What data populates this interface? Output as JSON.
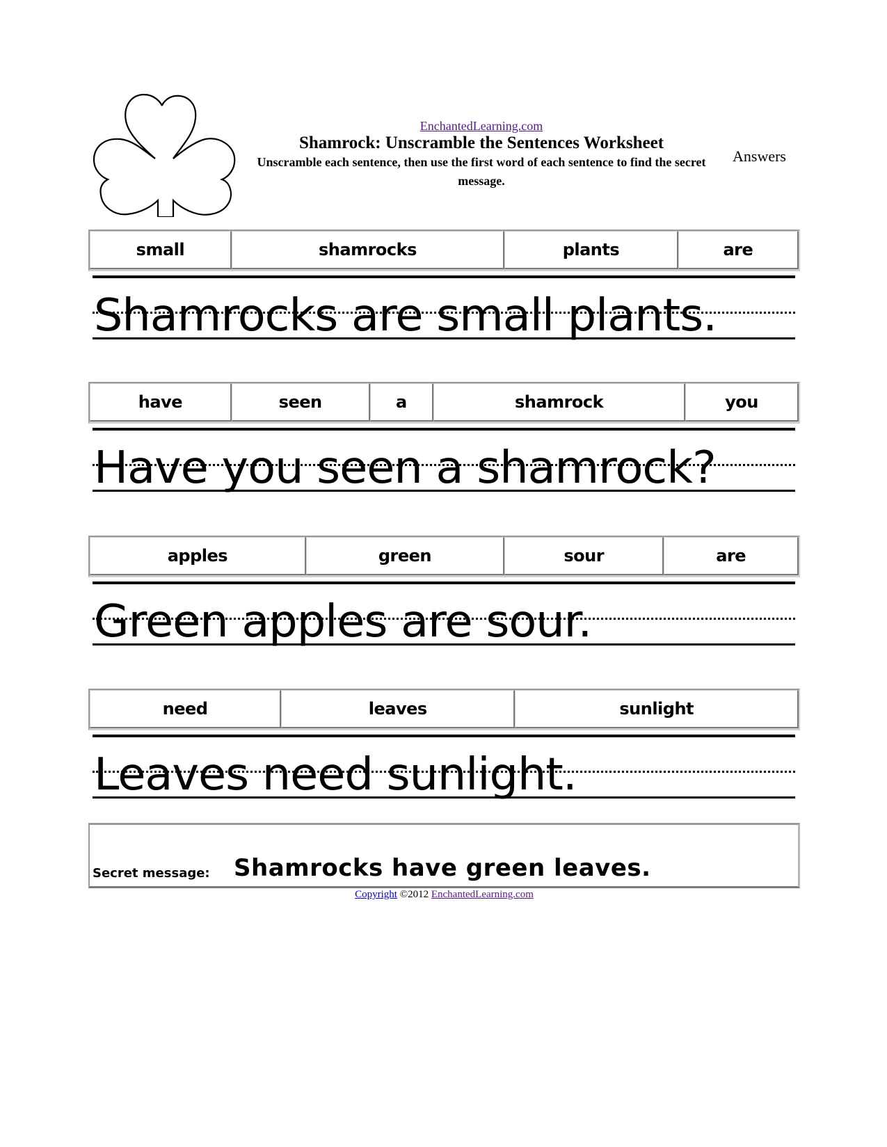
{
  "header": {
    "site_link": "EnchantedLearning.com",
    "title": "Shamrock: Unscramble the Sentences Worksheet",
    "subtitle": "Unscramble each sentence, then use the first word of each sentence to find the secret message.",
    "answers_label": "Answers",
    "image": "shamrock-outline-icon"
  },
  "exercises": [
    {
      "words": [
        "small",
        "shamrocks",
        "plants",
        "are"
      ],
      "answer": "Shamrocks are small plants."
    },
    {
      "words": [
        "have",
        "seen",
        "a",
        "shamrock",
        "you"
      ],
      "answer": "Have you seen a shamrock?"
    },
    {
      "words": [
        "apples",
        "green",
        "sour",
        "are"
      ],
      "answer": "Green apples are sour."
    },
    {
      "words": [
        "need",
        "leaves",
        "sunlight"
      ],
      "answer": "Leaves need sunlight."
    }
  ],
  "secret": {
    "label": "Secret message:",
    "text": "Shamrocks have green leaves."
  },
  "footer": {
    "copyright_link": "Copyright",
    "year_text": " ©2012 ",
    "site_link": "EnchantedLearning.com"
  }
}
